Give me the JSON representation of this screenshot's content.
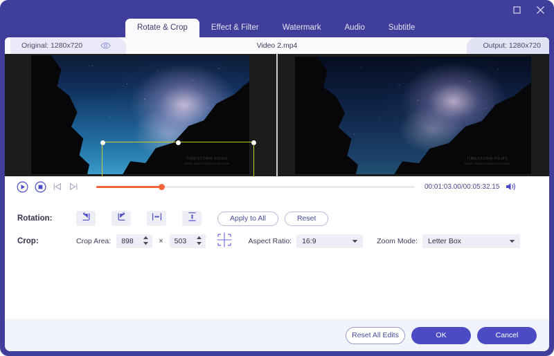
{
  "window": {
    "maximize_label": "Maximize",
    "close_label": "Close",
    "accent_color": "#3f3f9b",
    "panel_color": "#ffffff",
    "slider_color": "#f4633a",
    "crop_border_color": "#c8cf27"
  },
  "tabs": [
    {
      "label": "Rotate & Crop",
      "active": true
    },
    {
      "label": "Effect & Filter",
      "active": false
    },
    {
      "label": "Watermark",
      "active": false
    },
    {
      "label": "Audio",
      "active": false
    },
    {
      "label": "Subtitle",
      "active": false
    }
  ],
  "info": {
    "original_label": "Original: 1280x720",
    "eye_icon": "eye-icon",
    "video_name": "Video 2.mp4",
    "output_label": "Output: 1280x720"
  },
  "preview": {
    "watermark_line1": "TIMESTORM FILMS",
    "watermark_line2": "WWW.TIMESTORMFILMS.COM",
    "crop_handles": 8
  },
  "transport": {
    "play_icon": "play-circle-icon",
    "stop_icon": "stop-circle-icon",
    "prev_frame_icon": "previous-frame-icon",
    "next_frame_icon": "next-frame-icon",
    "volume_icon": "volume-icon",
    "progress_percent": 20.5,
    "timecode": "00:01:03.00/00:05:32.15",
    "current_time": "00:01:03.00",
    "total_time": "00:05:32.15"
  },
  "rotation": {
    "label": "Rotation:",
    "buttons": [
      {
        "name": "rotate-left-icon"
      },
      {
        "name": "rotate-right-icon"
      },
      {
        "name": "flip-horizontal-icon"
      },
      {
        "name": "flip-vertical-icon"
      }
    ],
    "apply_to_all_label": "Apply to All",
    "reset_label": "Reset"
  },
  "crop": {
    "label": "Crop:",
    "crop_area_label": "Crop Area:",
    "width_value": "898",
    "height_value": "503",
    "multiply_symbol": "×",
    "center_icon": "center-crop-icon",
    "aspect_ratio_label": "Aspect Ratio:",
    "aspect_ratio_value": "16:9",
    "zoom_mode_label": "Zoom Mode:",
    "zoom_mode_value": "Letter Box"
  },
  "footer": {
    "reset_all_label": "Reset All Edits",
    "ok_label": "OK",
    "cancel_label": "Cancel"
  }
}
